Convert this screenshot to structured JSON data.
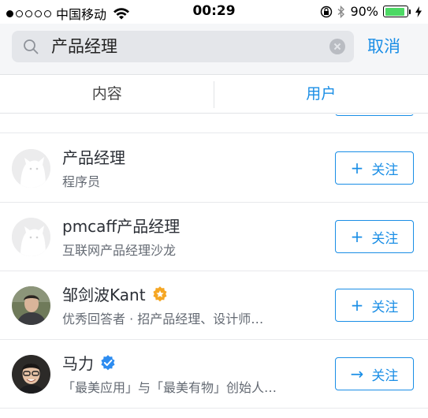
{
  "status_bar": {
    "carrier": "中国移动",
    "time": "00:29",
    "battery_percent": "90%",
    "battery_level": 0.9,
    "signal_bars": 1,
    "signal_total": 5
  },
  "search": {
    "query": "产品经理",
    "cancel_label": "取消"
  },
  "tabs": [
    {
      "label": "内容",
      "active": false
    },
    {
      "label": "用户",
      "active": true
    }
  ],
  "users": [
    {
      "name": "产品经理",
      "subtitle": "程序员",
      "avatar": "default-avatar",
      "badge": null,
      "follow_icon": "+",
      "follow_label": "关注"
    },
    {
      "name": "pmcaff产品经理",
      "subtitle": "互联网产品经理沙龙",
      "avatar": "default-avatar",
      "badge": null,
      "follow_icon": "+",
      "follow_label": "关注"
    },
    {
      "name": "邹剑波Kant",
      "subtitle": "优秀回答者 · 招产品经理、设计师…",
      "avatar": "photo-avatar",
      "badge": "orange-star-badge",
      "follow_icon": "+",
      "follow_label": "关注"
    },
    {
      "name": "马力",
      "subtitle": "「最美应用」与「最美有物」创始人…",
      "avatar": "photo-avatar",
      "badge": "blue-check-badge",
      "follow_icon": "→",
      "follow_label": "关注"
    }
  ],
  "colors": {
    "accent": "#1a8ee6",
    "badge_orange": "#f5a623",
    "badge_blue": "#2d8cf0",
    "battery_green": "#4cd964"
  }
}
